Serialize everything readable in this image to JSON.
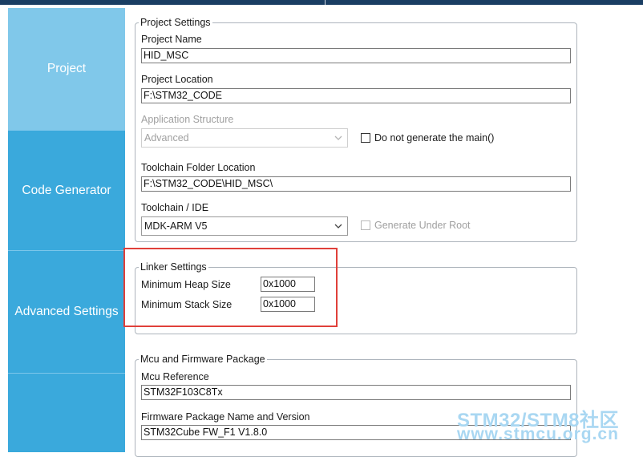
{
  "sidebar": {
    "items": [
      {
        "label": "Project",
        "active": true
      },
      {
        "label": "Code Generator",
        "active": false
      },
      {
        "label": "Advanced Settings",
        "active": false
      },
      {
        "label": "",
        "active": false
      }
    ]
  },
  "project_settings": {
    "legend": "Project Settings",
    "project_name_label": "Project Name",
    "project_name_value": "HID_MSC",
    "project_location_label": "Project Location",
    "project_location_value": "F:\\STM32_CODE",
    "app_structure_label": "Application Structure",
    "app_structure_value": "Advanced",
    "no_main_label": "Do not generate the main()",
    "toolchain_folder_label": "Toolchain Folder Location",
    "toolchain_folder_value": "F:\\STM32_CODE\\HID_MSC\\",
    "toolchain_ide_label": "Toolchain / IDE",
    "toolchain_ide_value": "MDK-ARM V5",
    "generate_under_root_label": "Generate Under Root"
  },
  "linker_settings": {
    "legend": "Linker Settings",
    "min_heap_label": "Minimum Heap Size",
    "min_heap_value": "0x1000",
    "min_stack_label": "Minimum Stack Size",
    "min_stack_value": "0x1000"
  },
  "mcu_package": {
    "legend": "Mcu and Firmware Package",
    "mcu_reference_label": "Mcu Reference",
    "mcu_reference_value": "STM32F103C8Tx",
    "firmware_label": "Firmware Package Name and Version",
    "firmware_value": "STM32Cube FW_F1 V1.8.0"
  },
  "watermark": {
    "line1": "STM32/STM8社区",
    "line2": "www.stmcu.org.cn"
  },
  "colors": {
    "sidebar": "#3aa9dc",
    "sidebar_active": "#80c8ea",
    "highlight": "#e0403a"
  }
}
